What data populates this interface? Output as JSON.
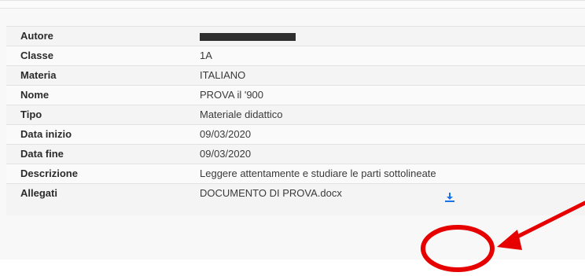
{
  "details": {
    "rows": [
      {
        "label": "Autore",
        "value": ""
      },
      {
        "label": "Classe",
        "value": "1A"
      },
      {
        "label": "Materia",
        "value": "ITALIANO"
      },
      {
        "label": "Nome",
        "value": "PROVA il '900"
      },
      {
        "label": "Tipo",
        "value": "Materiale didattico"
      },
      {
        "label": "Data inizio",
        "value": "09/03/2020"
      },
      {
        "label": "Data fine",
        "value": "09/03/2020"
      },
      {
        "label": "Descrizione",
        "value": "Leggere attentamente e studiare le parti sottolineate"
      },
      {
        "label": "Allegati",
        "value": "DOCUMENTO DI PROVA.docx"
      }
    ]
  },
  "icons": {
    "download": "download-icon"
  },
  "colors": {
    "download_icon": "#1a73e8",
    "annotation": "#e60000"
  }
}
